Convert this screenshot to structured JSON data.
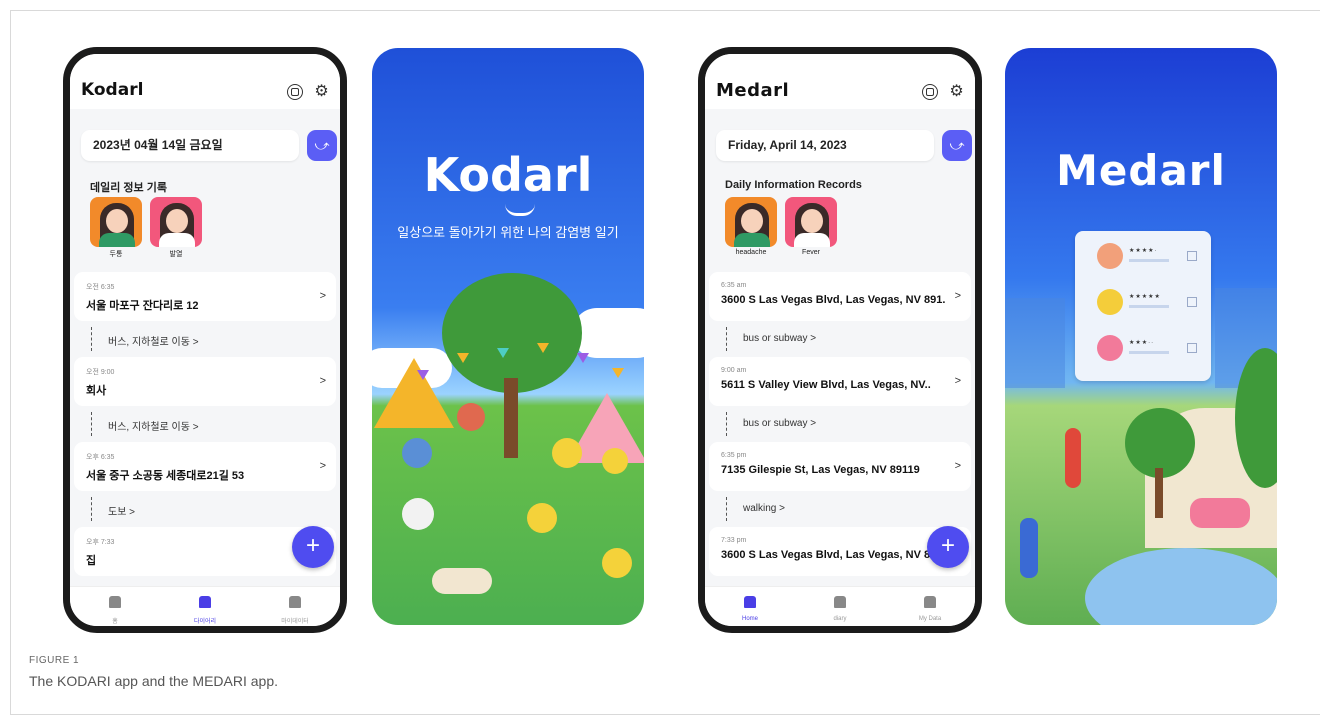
{
  "kodari": {
    "brand": "Kodarl",
    "date": "2023년 04월 14일 금요일",
    "section_title": "데일리 정보 기록",
    "symptoms": [
      "두통",
      "발열"
    ],
    "timeline": [
      {
        "time": "오전 6:35",
        "place": "서울 마포구 잔다리로 12",
        "move": "버스, 지하철로 이동 >"
      },
      {
        "time": "오전 9:00",
        "place": "회사",
        "move": "버스, 지하철로 이동 >"
      },
      {
        "time": "오후 6:35",
        "place": "서울 중구 소공동 세종대로21길 53",
        "move": "도보 >"
      },
      {
        "time": "오후 7:33",
        "place": "집",
        "move": ""
      }
    ],
    "tabs": [
      "홈",
      "다이어리",
      "마이데이터"
    ],
    "splash_title": "Kodarl",
    "splash_subtitle": "일상으로 돌아가기 위한 나의 감염병 일기"
  },
  "medari": {
    "brand": "Medarl",
    "date": "Friday, April 14, 2023",
    "section_title": "Daily Information Records",
    "symptoms": [
      "headache",
      "Fever"
    ],
    "timeline": [
      {
        "time": "6:35 am",
        "place": "3600 S Las Vegas Blvd, Las Vegas, NV 891..",
        "move": "bus or subway >"
      },
      {
        "time": "9:00 am",
        "place": "5611 S Valley View Blvd, Las Vegas, NV..",
        "move": "bus or subway >"
      },
      {
        "time": "6:35 pm",
        "place": "7135 Gilespie St, Las Vegas, NV 89119",
        "move": "walking >"
      },
      {
        "time": "7:33 pm",
        "place": "3600 S Las Vegas Blvd, Las Vegas, NV 8",
        "move": ""
      }
    ],
    "tabs": [
      "Home",
      "diary",
      "My Data"
    ],
    "splash_title": "Medarl"
  },
  "ui": {
    "fab": "+",
    "chevron": ">",
    "accent": "#4f4cf0"
  },
  "icons": [
    "chat-icon",
    "gear-icon",
    "route-icon",
    "home-icon",
    "diary-icon",
    "mydata-icon",
    "plus-icon"
  ],
  "caption": {
    "label": "FIGURE 1",
    "text": "The KODARI app and the MEDARI app."
  }
}
